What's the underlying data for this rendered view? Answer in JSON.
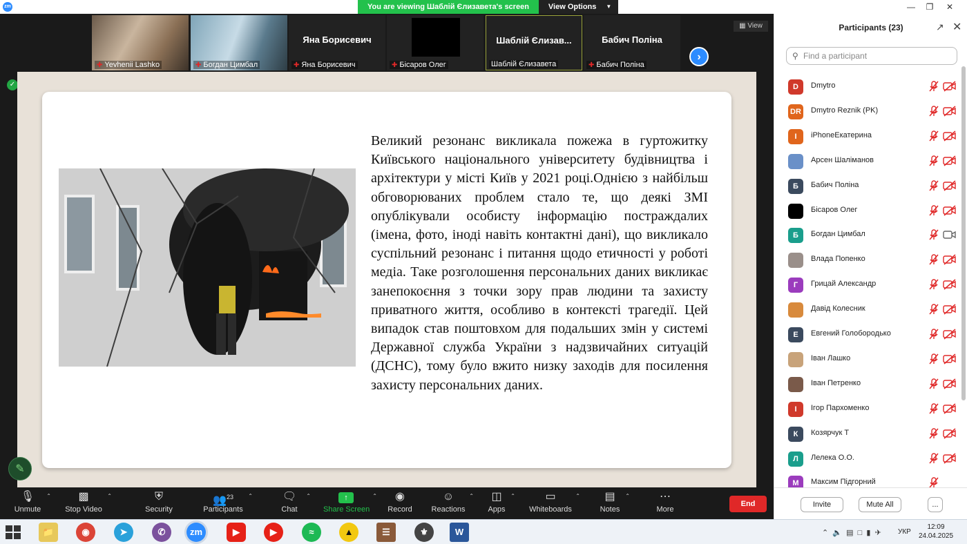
{
  "window": {
    "logo": "zm",
    "viewing_text": "You are viewing Шаблій Єлизавета's screen",
    "view_options_label": "View Options"
  },
  "gallery": {
    "tiles": [
      {
        "name": "Yevhenii Lashko",
        "big": ""
      },
      {
        "name": "Богдан Цимбал",
        "big": ""
      },
      {
        "name": "Яна Борисевич",
        "big": "Яна Борисевич"
      },
      {
        "name": "Бісаров Олег",
        "big": ""
      },
      {
        "name": "Шаблій Єлизавета",
        "big": "Шаблій Єлизав..."
      },
      {
        "name": "Бабич Поліна",
        "big": "Бабич Поліна"
      }
    ],
    "view_button": "View"
  },
  "slide": {
    "text": "Великий резонанс викликала пожежа в гуртожитку Київського національного університету будівництва і архітектури у місті Київ у 2021 році.Однією з найбільш обговорюваних проблем стало те, що деякі ЗМІ опублікували особисту інформацію постраждалих (імена, фото, іноді навіть контактні дані), що викликало суспільний резонанс і питання щодо етичності у роботі медіа. Таке розголошення персональних даних викликає занепокоєння з точки зору прав людини та захисту приватного життя, особливо в контексті трагедії. Цей випадок став поштовхом для подальших змін у системі Державної служба України з надзвичайних ситуацій (ДСНС), тому було вжито низку заходів для посилення захисту персональних даних."
  },
  "toolbar": {
    "unmute": "Unmute",
    "stop_video": "Stop Video",
    "security": "Security",
    "participants": "Participants",
    "participants_count": "23",
    "chat": "Chat",
    "share_screen": "Share Screen",
    "record": "Record",
    "reactions": "Reactions",
    "apps": "Apps",
    "whiteboards": "Whiteboards",
    "notes": "Notes",
    "more": "More",
    "end": "End"
  },
  "panel": {
    "title": "Participants (23)",
    "search_placeholder": "Find a participant",
    "invite": "Invite",
    "mute_all": "Mute All",
    "more": "...",
    "participants": [
      {
        "name": "Dmytro",
        "initials": "D",
        "color": "#d0392b",
        "cam": "off"
      },
      {
        "name": "Dmytro Reznik (PK)",
        "initials": "DR",
        "color": "#e0651c",
        "cam": "off"
      },
      {
        "name": "iPhoneЕкатерина",
        "initials": "I",
        "color": "#e0651c",
        "cam": "off"
      },
      {
        "name": "Арсен Шаліманов",
        "initials": "",
        "color": "#6a90c8",
        "cam": "off"
      },
      {
        "name": "Бабич Поліна",
        "initials": "Б",
        "color": "#3b4a5e",
        "cam": "off"
      },
      {
        "name": "Бісаров Олег",
        "initials": "",
        "color": "#000000",
        "cam": "off"
      },
      {
        "name": "Богдан Цимбал",
        "initials": "Б",
        "color": "#1a9e8c",
        "cam": "on"
      },
      {
        "name": "Влада Попенко",
        "initials": "",
        "color": "#9a8f8a",
        "cam": "off"
      },
      {
        "name": "Грицай Александр",
        "initials": "Г",
        "color": "#9b3cbd",
        "cam": "off"
      },
      {
        "name": "Давід Колесник",
        "initials": "",
        "color": "#d88a3c",
        "cam": "off"
      },
      {
        "name": "Евгений Голобородько",
        "initials": "Е",
        "color": "#3b4a5e",
        "cam": "off"
      },
      {
        "name": "Іван Лашко",
        "initials": "",
        "color": "#c8a37a",
        "cam": "off"
      },
      {
        "name": "Іван Петренко",
        "initials": "",
        "color": "#7a5a4a",
        "cam": "off"
      },
      {
        "name": "Ігор Пархоменко",
        "initials": "І",
        "color": "#d0392b",
        "cam": "off"
      },
      {
        "name": "Козярчук Т",
        "initials": "К",
        "color": "#3b4a5e",
        "cam": "off"
      },
      {
        "name": "Лелека О.О.",
        "initials": "Л",
        "color": "#1a9e8c",
        "cam": "off"
      },
      {
        "name": "Максим Підгорний",
        "initials": "М",
        "color": "#9b3cbd",
        "cam": "none"
      }
    ]
  },
  "taskbar": {
    "time": "12:09",
    "date": "24.04.2025",
    "lang": "УКР"
  }
}
